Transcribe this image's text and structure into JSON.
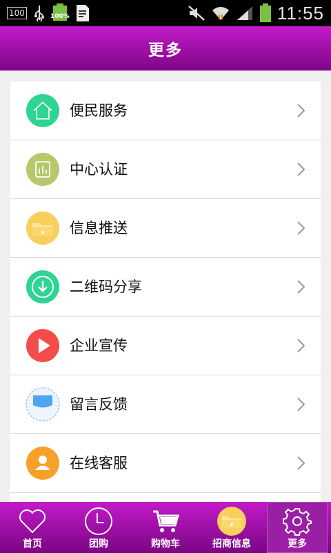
{
  "status_bar": {
    "left_box": "100",
    "battery_pct": "100%",
    "time": "11:55"
  },
  "header": {
    "title": "更多"
  },
  "menu": {
    "items": [
      {
        "label": "便民服务",
        "icon": "home-icon",
        "color": "#2ed492"
      },
      {
        "label": "中心认证",
        "icon": "chart-icon",
        "color": "#b5c86a"
      },
      {
        "label": "信息推送",
        "icon": "folder-icon",
        "color": "#f7cf5a"
      },
      {
        "label": "二维码分享",
        "icon": "download-icon",
        "color": "#2ed492"
      },
      {
        "label": "企业宣传",
        "icon": "play-icon",
        "color": "#f44b4b"
      },
      {
        "label": "留言反馈",
        "icon": "message-icon",
        "color": "#4da6ef"
      },
      {
        "label": "在线客服",
        "icon": "person-icon",
        "color": "#f6a229"
      }
    ]
  },
  "tabbar": {
    "items": [
      {
        "label": "首页",
        "icon": "heart-icon"
      },
      {
        "label": "团购",
        "icon": "clock-icon"
      },
      {
        "label": "购物车",
        "icon": "cart-icon"
      },
      {
        "label": "招商信息",
        "icon": "folder-icon"
      },
      {
        "label": "更多",
        "icon": "gear-icon",
        "active": true
      }
    ]
  }
}
